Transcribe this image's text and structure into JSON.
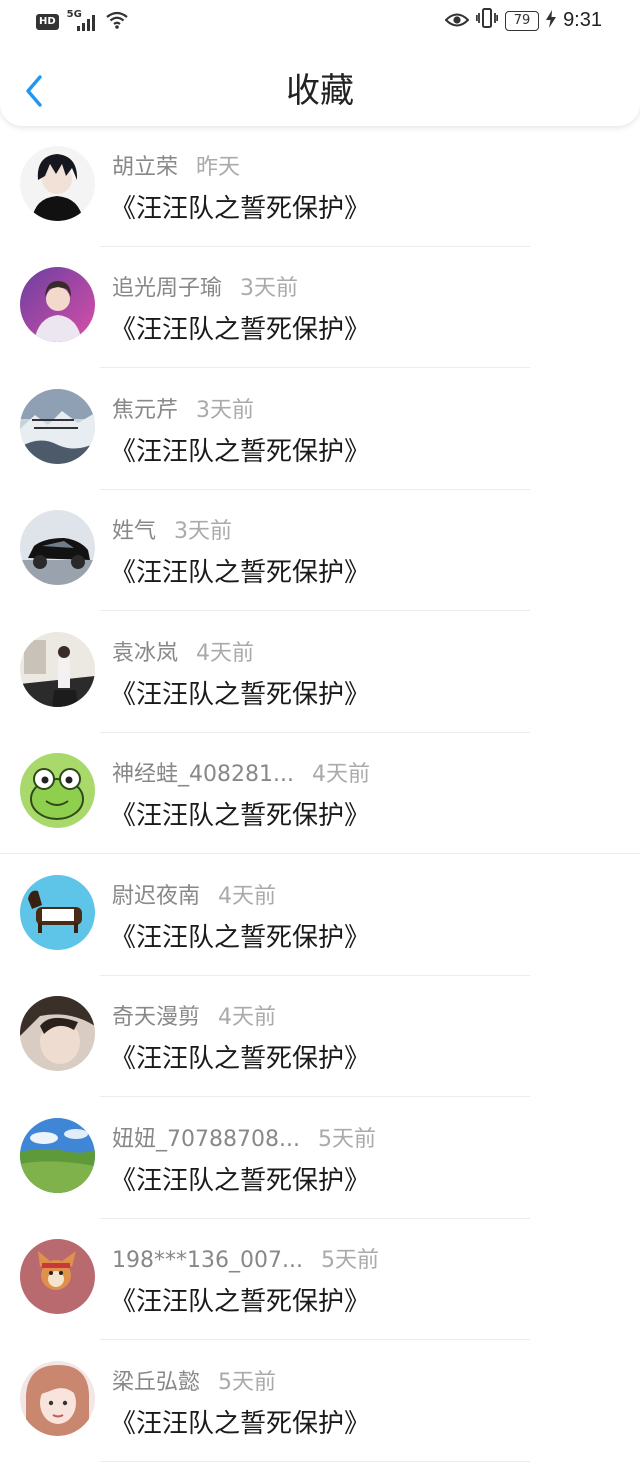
{
  "status_bar": {
    "hd": "HD",
    "network": "5G",
    "battery": "79",
    "time": "9:31"
  },
  "header": {
    "title": "收藏"
  },
  "favorites": [
    {
      "user": "胡立荣",
      "time": "昨天",
      "title": "《汪汪队之誓死保护》"
    },
    {
      "user": "追光周子瑜",
      "time": "3天前",
      "title": "《汪汪队之誓死保护》"
    },
    {
      "user": "焦元芹",
      "time": "3天前",
      "title": "《汪汪队之誓死保护》"
    },
    {
      "user": "姓气",
      "time": "3天前",
      "title": "《汪汪队之誓死保护》"
    },
    {
      "user": "袁冰岚",
      "time": "4天前",
      "title": "《汪汪队之誓死保护》"
    },
    {
      "user": "神经蛙_408281...",
      "time": "4天前",
      "title": "《汪汪队之誓死保护》"
    },
    {
      "user": "尉迟夜南",
      "time": "4天前",
      "title": "《汪汪队之誓死保护》"
    },
    {
      "user": "奇天漫剪",
      "time": "4天前",
      "title": "《汪汪队之誓死保护》"
    },
    {
      "user": "妞妞_70788708...",
      "time": "5天前",
      "title": "《汪汪队之誓死保护》"
    },
    {
      "user": "198***136_007...",
      "time": "5天前",
      "title": "《汪汪队之誓死保护》"
    },
    {
      "user": "梁丘弘懿",
      "time": "5天前",
      "title": "《汪汪队之誓死保护》"
    }
  ],
  "colors": {
    "accent": "#2196f3",
    "username": "#888888",
    "time_ago": "#aaaaaa"
  }
}
